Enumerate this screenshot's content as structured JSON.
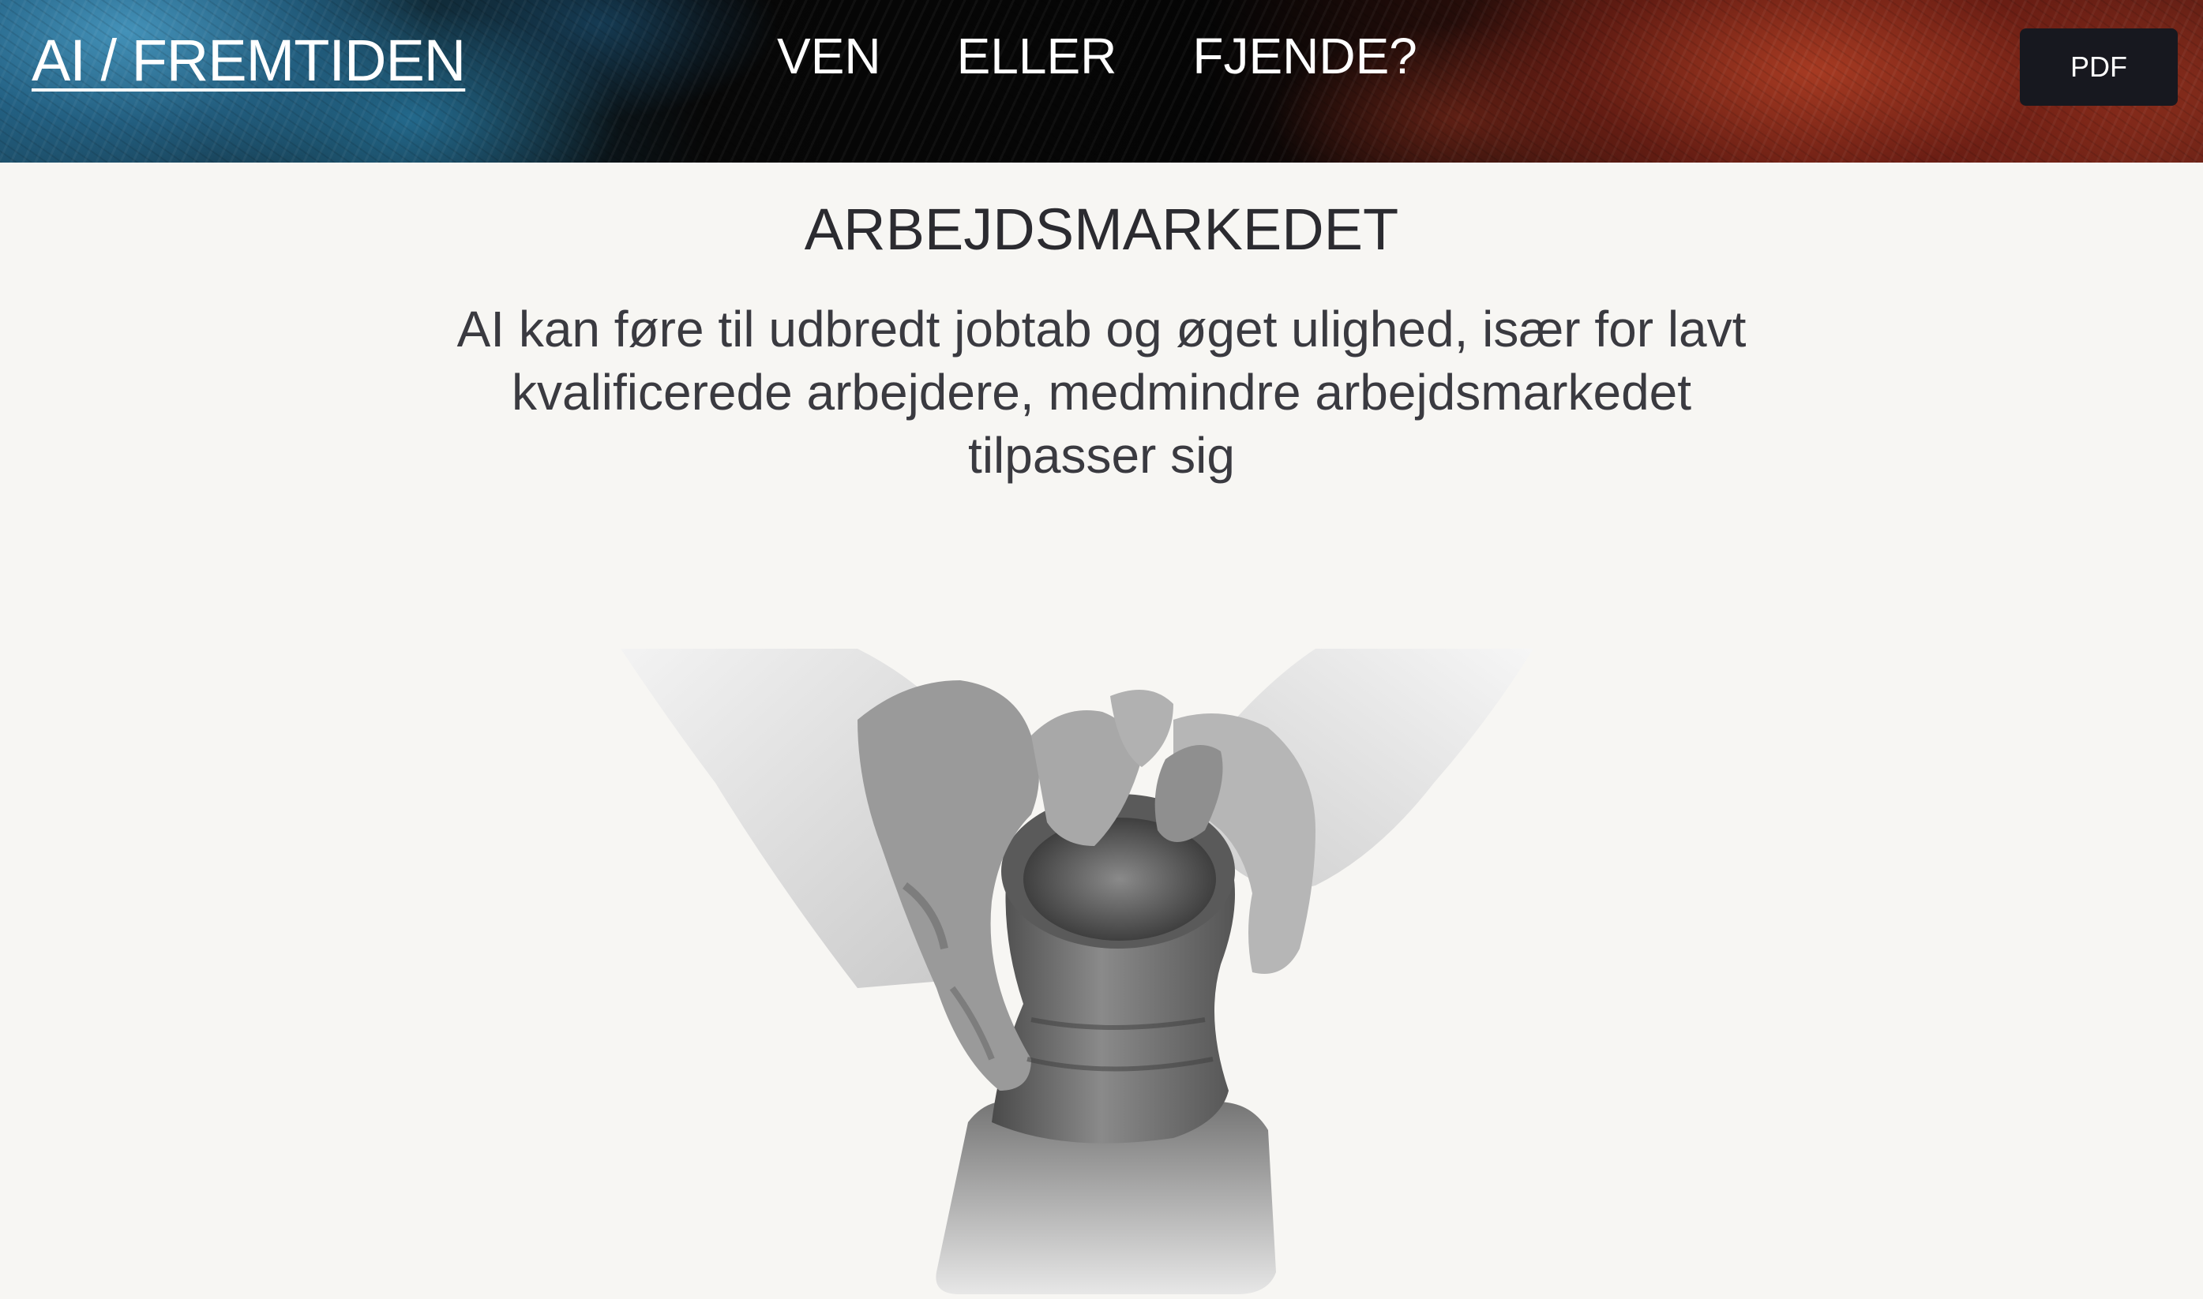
{
  "header": {
    "brand": "AI / FREMTIDEN",
    "nav": [
      "VEN",
      "ELLER",
      "FJENDE?"
    ],
    "pdf_label": "PDF"
  },
  "section": {
    "title": "ARBEJDSMARKEDET",
    "text": "AI kan føre til udbredt jobtab og øget ulighed, især for lavt kvalificerede arbejdere, medmindre arbejdsmarkedet tilpasser sig"
  },
  "image": {
    "subject": "hands shaping clay pot on pottery wheel (black and white)"
  },
  "colors": {
    "page_background": "#f7f6f3",
    "header_text": "#ffffff",
    "pdf_button": "#17181f",
    "title_text": "#2b2b30"
  }
}
